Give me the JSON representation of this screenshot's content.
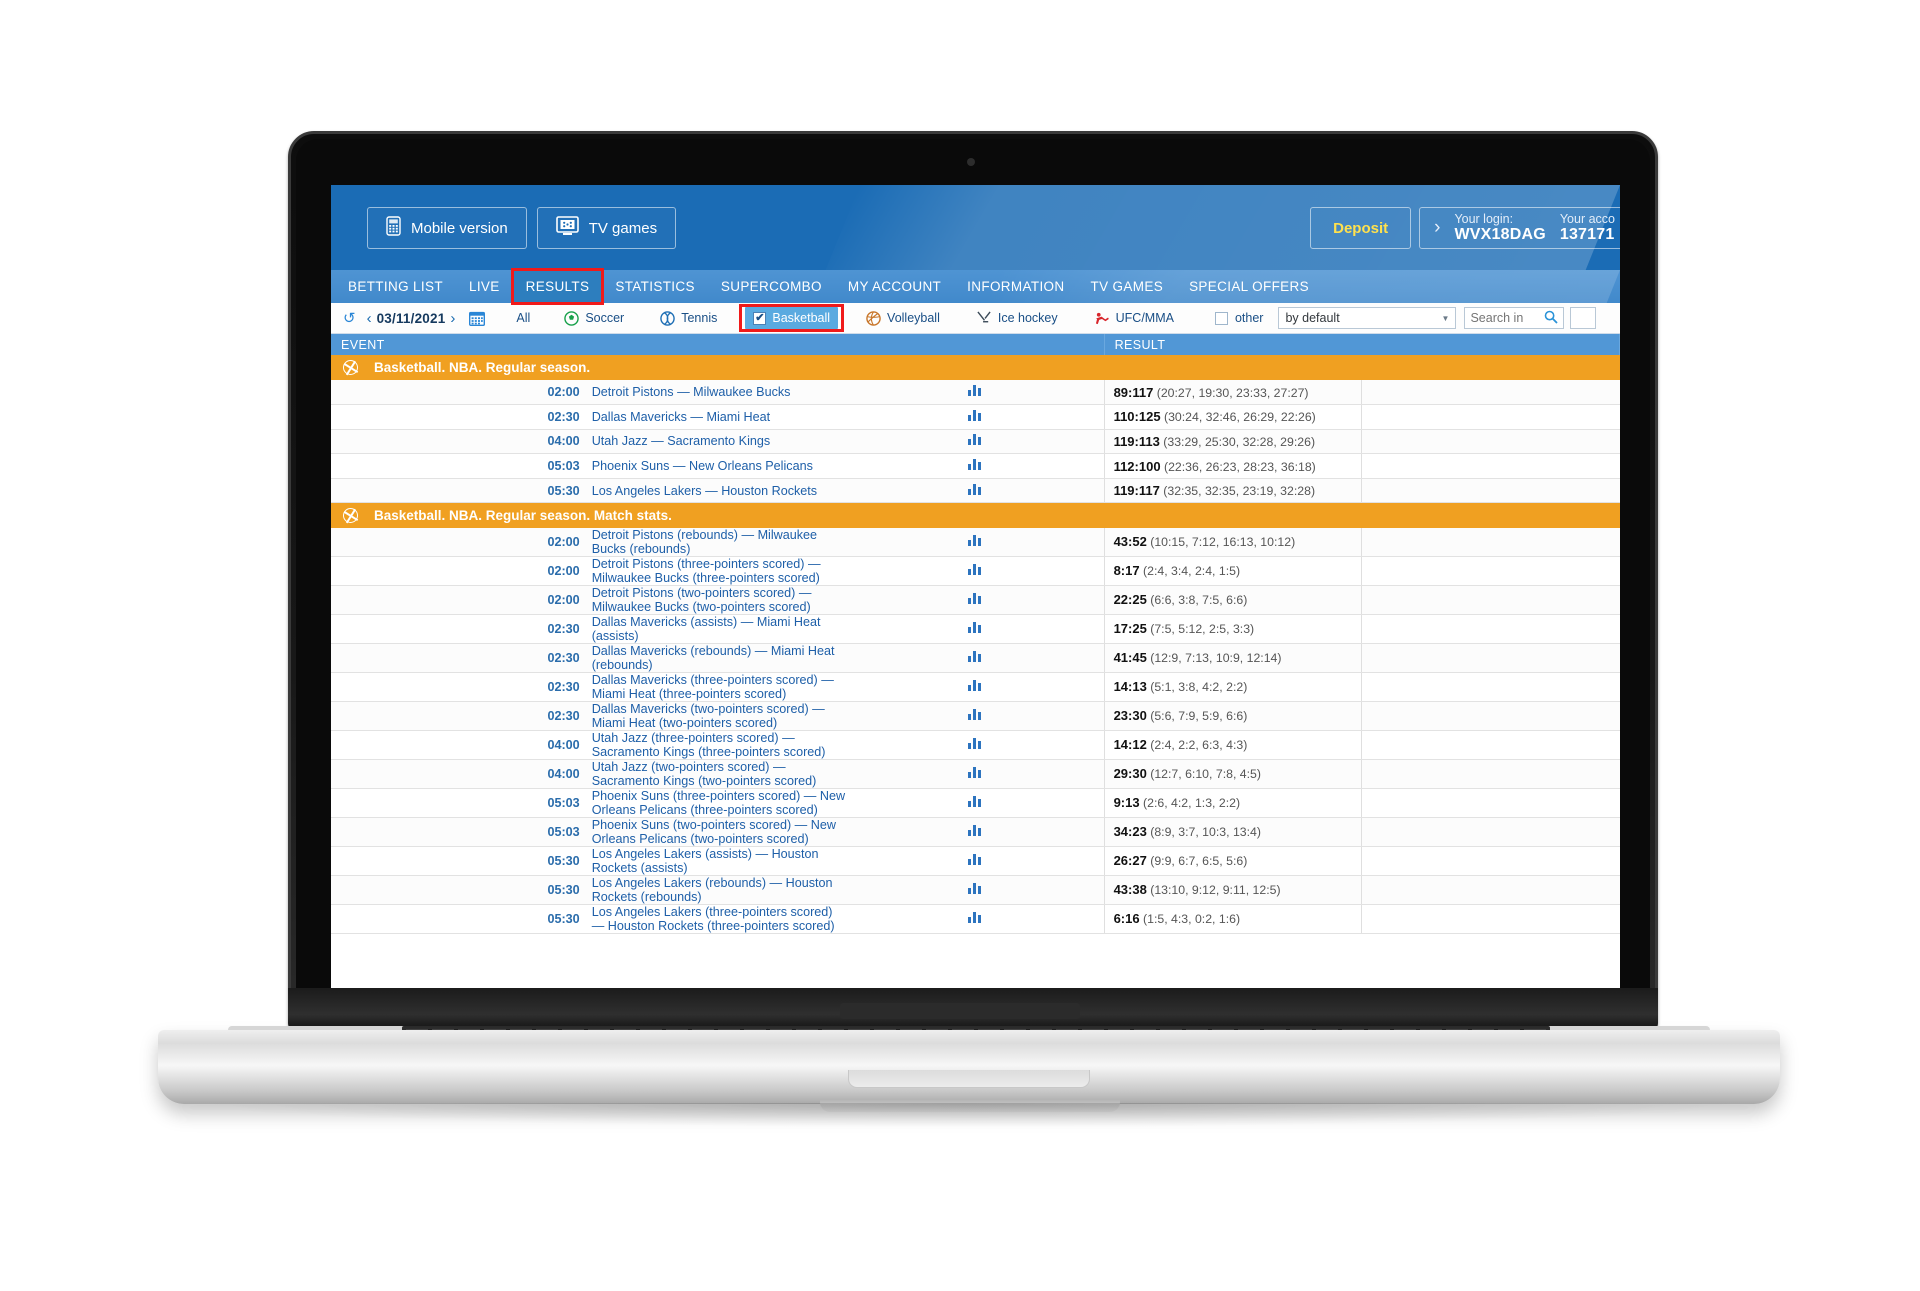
{
  "header": {
    "mobile_version_label": "Mobile version",
    "tv_games_label": "TV games",
    "mobile_icon": "mobile-phone-icon",
    "tv_icon": "tv-games-icon",
    "deposit_label": "Deposit",
    "chevron": "›",
    "login_label": "Your login:",
    "login_value": "WVX18DAG",
    "account_label": "Your acco",
    "account_value": "137171",
    "brand_color": "#1b6cb5"
  },
  "nav": {
    "items": [
      {
        "label": "BETTING LIST",
        "active": false,
        "highlighted": false
      },
      {
        "label": "LIVE",
        "active": false,
        "highlighted": false
      },
      {
        "label": "RESULTS",
        "active": true,
        "highlighted": true
      },
      {
        "label": "STATISTICS",
        "active": false,
        "highlighted": false
      },
      {
        "label": "SUPERCOMBO",
        "active": false,
        "highlighted": false
      },
      {
        "label": "MY ACCOUNT",
        "active": false,
        "highlighted": false
      },
      {
        "label": "INFORMATION",
        "active": false,
        "highlighted": false
      },
      {
        "label": "TV GAMES",
        "active": false,
        "highlighted": false
      },
      {
        "label": "SPECIAL OFFERS",
        "active": false,
        "highlighted": false
      }
    ],
    "highlight_color": "#f01a1a"
  },
  "filterbar": {
    "refresh_icon": "refresh-icon",
    "prev_icon": "‹",
    "next_icon": "›",
    "date": "03/11/2021",
    "calendar_icon": "calendar-icon",
    "all_label": "All",
    "sports": [
      {
        "label": "Soccer",
        "icon": "soccer-ball-icon",
        "selected": false,
        "checkbox": false
      },
      {
        "label": "Tennis",
        "icon": "tennis-ball-icon",
        "selected": false,
        "checkbox": false
      },
      {
        "label": "Basketball",
        "icon": "checkbox-checked-icon",
        "selected": true,
        "checkbox": true,
        "highlighted": true
      },
      {
        "label": "Volleyball",
        "icon": "volleyball-icon",
        "selected": false,
        "checkbox": false
      },
      {
        "label": "Ice hockey",
        "icon": "hockey-sticks-icon",
        "selected": false,
        "checkbox": false
      },
      {
        "label": "UFC/MMA",
        "icon": "ufc-icon",
        "selected": false,
        "checkbox": false
      }
    ],
    "other_label": "other",
    "other_checked": false,
    "sort_value": "by default",
    "sort_caret": "▼",
    "search_placeholder": "Search in ",
    "search_value": "",
    "search_icon": "magnifier-icon"
  },
  "table": {
    "columns": [
      "EVENT",
      "RESULT"
    ],
    "groups": [
      {
        "title": "Basketball. NBA. Regular season.",
        "icon": "basketball-icon",
        "rows": [
          {
            "time": "02:00",
            "event": "Detroit Pistons — Milwaukee Bucks",
            "score": "89:117",
            "periods": "(20:27, 19:30, 23:33, 27:27)",
            "stats_icon": "bar-chart-icon"
          },
          {
            "time": "02:30",
            "event": "Dallas Mavericks — Miami Heat",
            "score": "110:125",
            "periods": "(30:24, 32:46, 26:29, 22:26)",
            "stats_icon": "bar-chart-icon"
          },
          {
            "time": "04:00",
            "event": "Utah Jazz — Sacramento Kings",
            "score": "119:113",
            "periods": "(33:29, 25:30, 32:28, 29:26)",
            "stats_icon": "bar-chart-icon"
          },
          {
            "time": "05:03",
            "event": "Phoenix Suns — New Orleans Pelicans",
            "score": "112:100",
            "periods": "(22:36, 26:23, 28:23, 36:18)",
            "stats_icon": "bar-chart-icon"
          },
          {
            "time": "05:30",
            "event": "Los Angeles Lakers — Houston Rockets",
            "score": "119:117",
            "periods": "(32:35, 32:35, 23:19, 32:28)",
            "stats_icon": "bar-chart-icon"
          }
        ]
      },
      {
        "title": "Basketball. NBA. Regular season. Match stats.",
        "icon": "basketball-icon",
        "rows": [
          {
            "time": "02:00",
            "event": "Detroit Pistons (rebounds) — Milwaukee Bucks (rebounds)",
            "score": "43:52",
            "periods": "(10:15, 7:12, 16:13, 10:12)",
            "stats_icon": "bar-chart-icon"
          },
          {
            "time": "02:00",
            "event": "Detroit Pistons (three-pointers scored) — Milwaukee Bucks (three-pointers scored)",
            "score": "8:17",
            "periods": "(2:4, 3:4, 2:4, 1:5)",
            "stats_icon": "bar-chart-icon"
          },
          {
            "time": "02:00",
            "event": "Detroit Pistons (two-pointers scored) — Milwaukee Bucks (two-pointers scored)",
            "score": "22:25",
            "periods": "(6:6, 3:8, 7:5, 6:6)",
            "stats_icon": "bar-chart-icon"
          },
          {
            "time": "02:30",
            "event": "Dallas Mavericks (assists) — Miami Heat (assists)",
            "score": "17:25",
            "periods": "(7:5, 5:12, 2:5, 3:3)",
            "stats_icon": "bar-chart-icon"
          },
          {
            "time": "02:30",
            "event": "Dallas Mavericks (rebounds) — Miami Heat (rebounds)",
            "score": "41:45",
            "periods": "(12:9, 7:13, 10:9, 12:14)",
            "stats_icon": "bar-chart-icon"
          },
          {
            "time": "02:30",
            "event": "Dallas Mavericks (three-pointers scored) — Miami Heat (three-pointers scored)",
            "score": "14:13",
            "periods": "(5:1, 3:8, 4:2, 2:2)",
            "stats_icon": "bar-chart-icon"
          },
          {
            "time": "02:30",
            "event": "Dallas Mavericks (two-pointers scored) — Miami Heat (two-pointers scored)",
            "score": "23:30",
            "periods": "(5:6, 7:9, 5:9, 6:6)",
            "stats_icon": "bar-chart-icon"
          },
          {
            "time": "04:00",
            "event": "Utah Jazz (three-pointers scored) — Sacramento Kings (three-pointers scored)",
            "score": "14:12",
            "periods": "(2:4, 2:2, 6:3, 4:3)",
            "stats_icon": "bar-chart-icon"
          },
          {
            "time": "04:00",
            "event": "Utah Jazz (two-pointers scored) — Sacramento Kings (two-pointers scored)",
            "score": "29:30",
            "periods": "(12:7, 6:10, 7:8, 4:5)",
            "stats_icon": "bar-chart-icon"
          },
          {
            "time": "05:03",
            "event": "Phoenix Suns (three-pointers scored) — New Orleans Pelicans (three-pointers scored)",
            "score": "9:13",
            "periods": "(2:6, 4:2, 1:3, 2:2)",
            "stats_icon": "bar-chart-icon"
          },
          {
            "time": "05:03",
            "event": "Phoenix Suns (two-pointers scored) — New Orleans Pelicans (two-pointers scored)",
            "score": "34:23",
            "periods": "(8:9, 3:7, 10:3, 13:4)",
            "stats_icon": "bar-chart-icon"
          },
          {
            "time": "05:30",
            "event": "Los Angeles Lakers (assists) — Houston Rockets (assists)",
            "score": "26:27",
            "periods": "(9:9, 6:7, 6:5, 5:6)",
            "stats_icon": "bar-chart-icon"
          },
          {
            "time": "05:30",
            "event": "Los Angeles Lakers (rebounds) — Houston Rockets (rebounds)",
            "score": "43:38",
            "periods": "(13:10, 9:12, 9:11, 12:5)",
            "stats_icon": "bar-chart-icon"
          },
          {
            "time": "05:30",
            "event": "Los Angeles Lakers (three-pointers scored) — Houston Rockets (three-pointers scored)",
            "score": "6:16",
            "periods": "(1:5, 4:3, 0:2, 1:6)",
            "stats_icon": "bar-chart-icon"
          }
        ]
      }
    ],
    "group_header_color": "#f0a021",
    "col_header_color": "#5197d6"
  }
}
